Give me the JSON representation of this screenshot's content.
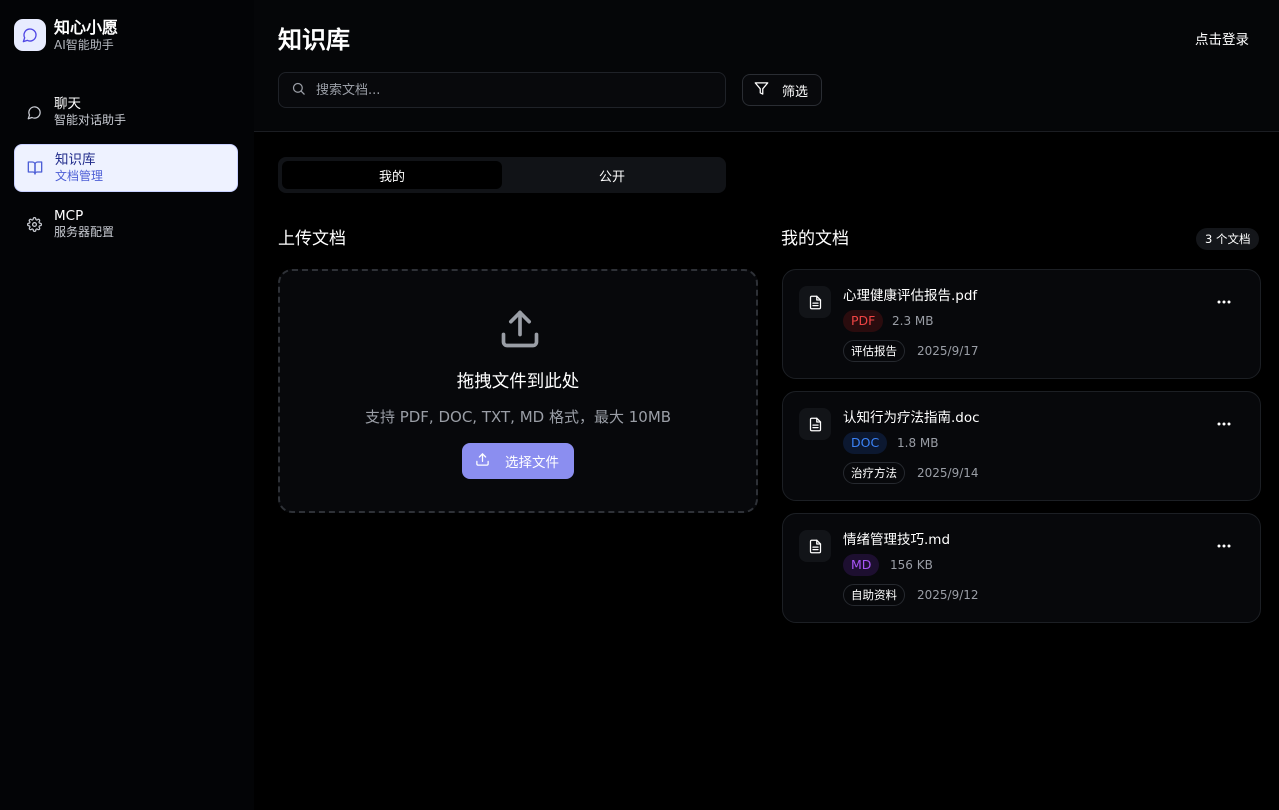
{
  "brand": {
    "name": "知心小愿",
    "subtitle": "AI智能助手"
  },
  "sidebar": {
    "items": [
      {
        "title": "聊天",
        "subtitle": "智能对话助手",
        "icon": "chat-bubble-icon",
        "active": false
      },
      {
        "title": "知识库",
        "subtitle": "文档管理",
        "icon": "book-open-icon",
        "active": true
      },
      {
        "title": "MCP",
        "subtitle": "服务器配置",
        "icon": "gear-icon",
        "active": false
      }
    ]
  },
  "header": {
    "title": "知识库",
    "login_label": "点击登录",
    "search_placeholder": "搜索文档...",
    "filter_label": "筛选"
  },
  "tabs": [
    {
      "label": "我的",
      "active": true
    },
    {
      "label": "公开",
      "active": false
    }
  ],
  "upload": {
    "section_title": "上传文档",
    "drop_title": "拖拽文件到此处",
    "drop_desc": "支持 PDF, DOC, TXT, MD 格式，最大 10MB",
    "button_label": "选择文件"
  },
  "documents": {
    "section_title": "我的文档",
    "count_label": "3 个文档",
    "items": [
      {
        "name": "心理健康评估报告.pdf",
        "type": "PDF",
        "type_color": "#ef4444",
        "type_bg": "#2a0c0e",
        "size": "2.3 MB",
        "tag": "评估报告",
        "date": "2025/9/17"
      },
      {
        "name": "认知行为疗法指南.doc",
        "type": "DOC",
        "type_color": "#3b82f6",
        "type_bg": "#0c1830",
        "size": "1.8 MB",
        "tag": "治疗方法",
        "date": "2025/9/14"
      },
      {
        "name": "情绪管理技巧.md",
        "type": "MD",
        "type_color": "#a855f7",
        "type_bg": "#1d0f30",
        "size": "156 KB",
        "tag": "自助资料",
        "date": "2025/9/12"
      }
    ]
  },
  "colors": {
    "accent": "#8b8ef0",
    "active_nav_bg": "#eef2ff",
    "active_nav_text": "#1f2a8a"
  }
}
